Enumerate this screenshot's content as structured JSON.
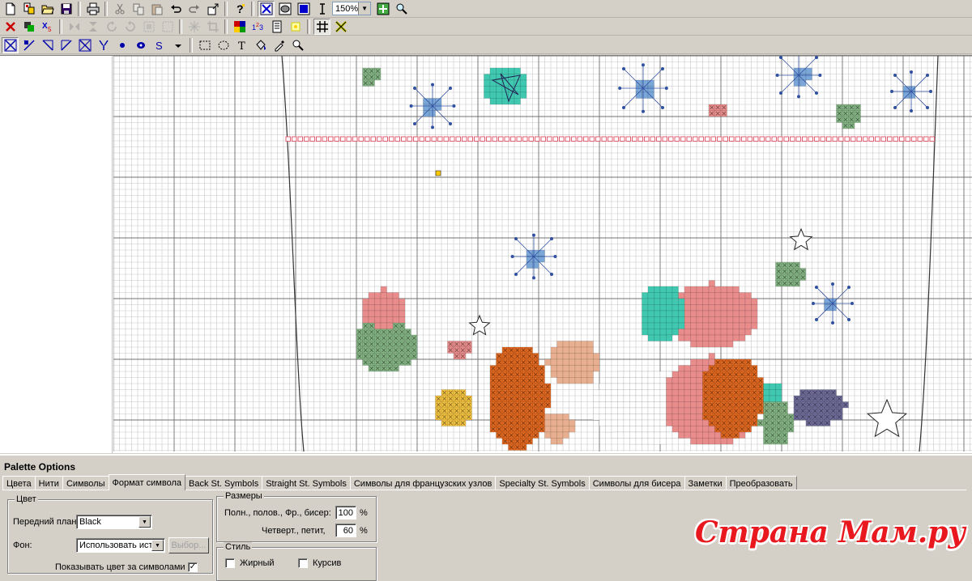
{
  "toolbar": {
    "zoom_value": "150%",
    "row1": [
      "new-file-icon",
      "new-from-template-icon",
      "open-folder-icon",
      "save-icon",
      "sep",
      "print-icon",
      "sep",
      "cut-icon",
      "copy-icon",
      "paste-icon",
      "undo-icon",
      "redo-icon",
      "export-icon",
      "sep",
      "help-icon",
      "sep",
      "cross-stitch-view-icon",
      "bead-view-icon",
      "solid-block-view-icon",
      "text-cursor-icon"
    ],
    "row1_after_zoom": [
      "fit-to-window-icon",
      "zoom-to-selection-icon"
    ],
    "row2": [
      "delete-icon",
      "paste-layer-icon",
      "swap-colors-icon",
      "sep",
      "flip-horizontal-icon",
      "flip-vertical-icon",
      "rotate-icon",
      "rotate-back-icon",
      "select-all-icon",
      "select-none-icon",
      "sep",
      "snowflake-icon",
      "crop-icon",
      "sep",
      "color-palette-icon",
      "number-sequence-icon",
      "chart-key-icon",
      "highlight-icon",
      "sep",
      "grid-toggle-icon",
      "cross-out-icon"
    ],
    "row3": [
      "full-stitch-icon",
      "half-stitch-icon",
      "quarter-stitch-icon",
      "three-quarter-stitch-icon",
      "petite-stitch-icon",
      "backstitch-icon",
      "french-knot-icon",
      "bead-icon",
      "specialty-stitch-icon",
      "dropdown-arrow-icon",
      "sep",
      "rectangle-select-icon",
      "lasso-select-icon",
      "text-tool-icon",
      "fill-bucket-icon",
      "eyedropper-icon",
      "magnifier-icon"
    ]
  },
  "palette": {
    "title": "Palette Options",
    "tabs": [
      "Цвета",
      "Нити",
      "Символы",
      "Формат символа",
      "Back St. Symbols",
      "Straight St. Symbols",
      "Символы для французских узлов",
      "Specialty St. Symbols",
      "Символы для бисера",
      "Заметки",
      "Преобразовать"
    ],
    "active_tab": 3,
    "color_group": {
      "legend": "Цвет",
      "foreground_label": "Передний план:",
      "foreground_value": "Black",
      "background_label": "Фон:",
      "background_value": "Использовать ист",
      "choose_button": "Выбор...",
      "show_color_label": "Показывать цвет за символами",
      "show_color_checked": true
    },
    "size_group": {
      "legend": "Размеры",
      "full_label": "Полн., полов., Фр., бисер:",
      "full_value": "100",
      "quarter_label": "Четверт., петит,",
      "quarter_value": "60",
      "unit": "%"
    },
    "style_group": {
      "legend": "Стиль",
      "bold_label": "Жирный",
      "italic_label": "Курсив"
    }
  },
  "watermark": "Страна Мам.ру",
  "colors": {
    "grid_line": "#c8c8c8",
    "grid_major": "#707070",
    "red_border": "#e06070",
    "teal": "#40c8b0",
    "blue": "#7aa6d8",
    "green": "#84b484",
    "rust": "#e06820",
    "salmon": "#e88c8c",
    "tan": "#e8b090",
    "purple": "#706c9a"
  }
}
